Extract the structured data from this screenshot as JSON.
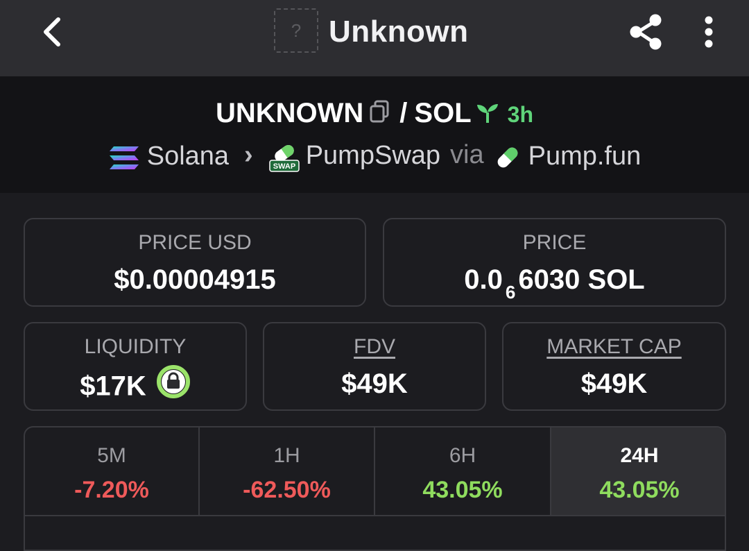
{
  "header": {
    "title": "Unknown",
    "placeholder_glyph": "?"
  },
  "pair": {
    "base": "UNKNOWN",
    "quote": "SOL",
    "separator": "/",
    "age": "3h",
    "chain": "Solana",
    "dex": "PumpSwap",
    "via_label": "via",
    "launchpad": "Pump.fun",
    "dex_badge": "SWAP"
  },
  "stats": {
    "price_usd": {
      "label": "PRICE USD",
      "value": "$0.00004915"
    },
    "price": {
      "label": "PRICE",
      "value_prefix": "0.0",
      "value_subscript": "6",
      "value_suffix": "6030 SOL"
    },
    "liquidity": {
      "label": "LIQUIDITY",
      "value": "$17K"
    },
    "fdv": {
      "label": "FDV",
      "value": "$49K"
    },
    "market_cap": {
      "label": "MARKET CAP",
      "value": "$49K"
    }
  },
  "timeframes": [
    {
      "label": "5M",
      "change": "-7.20%",
      "trend": "negative"
    },
    {
      "label": "1H",
      "change": "-62.50%",
      "trend": "negative"
    },
    {
      "label": "6H",
      "change": "43.05%",
      "trend": "positive"
    },
    {
      "label": "24H",
      "change": "43.05%",
      "trend": "positive",
      "active": true
    }
  ],
  "colors": {
    "background": "#1c1c20",
    "topbar": "#2d2d31",
    "pair_header": "#131316",
    "positive": "#8fdc5e",
    "negative": "#ef5a5a",
    "age_green": "#5fd47a",
    "lock_ring": "#9be36a"
  },
  "icons": [
    "back-arrow-icon",
    "token-placeholder-icon",
    "share-icon",
    "more-vertical-icon",
    "copy-icon",
    "sprout-icon",
    "solana-logo-icon",
    "pumpswap-logo-icon",
    "pumpfun-logo-icon",
    "lock-icon"
  ]
}
